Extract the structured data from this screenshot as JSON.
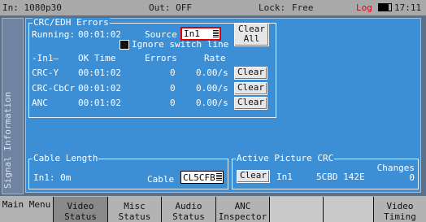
{
  "topbar": {
    "format": "In: 1080p30",
    "output": "Out: OFF",
    "lock_label": "Lock:",
    "lock_value": "Free",
    "log": "Log",
    "time": "17:11"
  },
  "side_tab": "Signal Information",
  "crc": {
    "title": "CRC/EDH Errors",
    "running_label": "Running:",
    "running_time": "00:01:02",
    "source_label": "Source",
    "source_value": "In1",
    "clear_all": [
      "Clear",
      "All"
    ],
    "ignore_label": "Ignore switch line",
    "header": {
      "name": "In1",
      "ok_time": "OK Time",
      "errors": "Errors",
      "rate": "Rate"
    },
    "rows": [
      {
        "name": "CRC-Y",
        "ok_time": "00:01:02",
        "errors": "0",
        "rate": "0.00/s",
        "clear": "Clear"
      },
      {
        "name": "CRC-CbCr",
        "ok_time": "00:01:02",
        "errors": "0",
        "rate": "0.00/s",
        "clear": "Clear"
      },
      {
        "name": "ANC",
        "ok_time": "00:01:02",
        "errors": "0",
        "rate": "0.00/s",
        "clear": "Clear"
      }
    ]
  },
  "cable": {
    "title": "Cable Length",
    "value": "In1: 0m",
    "cable_label": "Cable",
    "cable_value": "CL5CFB"
  },
  "picture_crc": {
    "title": "Active Picture CRC",
    "changes_label": "Changes",
    "clear": "Clear",
    "input": "In1",
    "crc_value": "5CBD 142E",
    "changes_value": "0"
  },
  "menu": [
    {
      "line1": "Main Menu",
      "line2": ""
    },
    {
      "line1": "Video",
      "line2": "Status"
    },
    {
      "line1": "Misc",
      "line2": "Status"
    },
    {
      "line1": "Audio",
      "line2": "Status"
    },
    {
      "line1": "ANC",
      "line2": "Inspector"
    },
    {
      "line1": "",
      "line2": ""
    },
    {
      "line1": "",
      "line2": ""
    },
    {
      "line1": "Video",
      "line2": "Timing"
    }
  ]
}
